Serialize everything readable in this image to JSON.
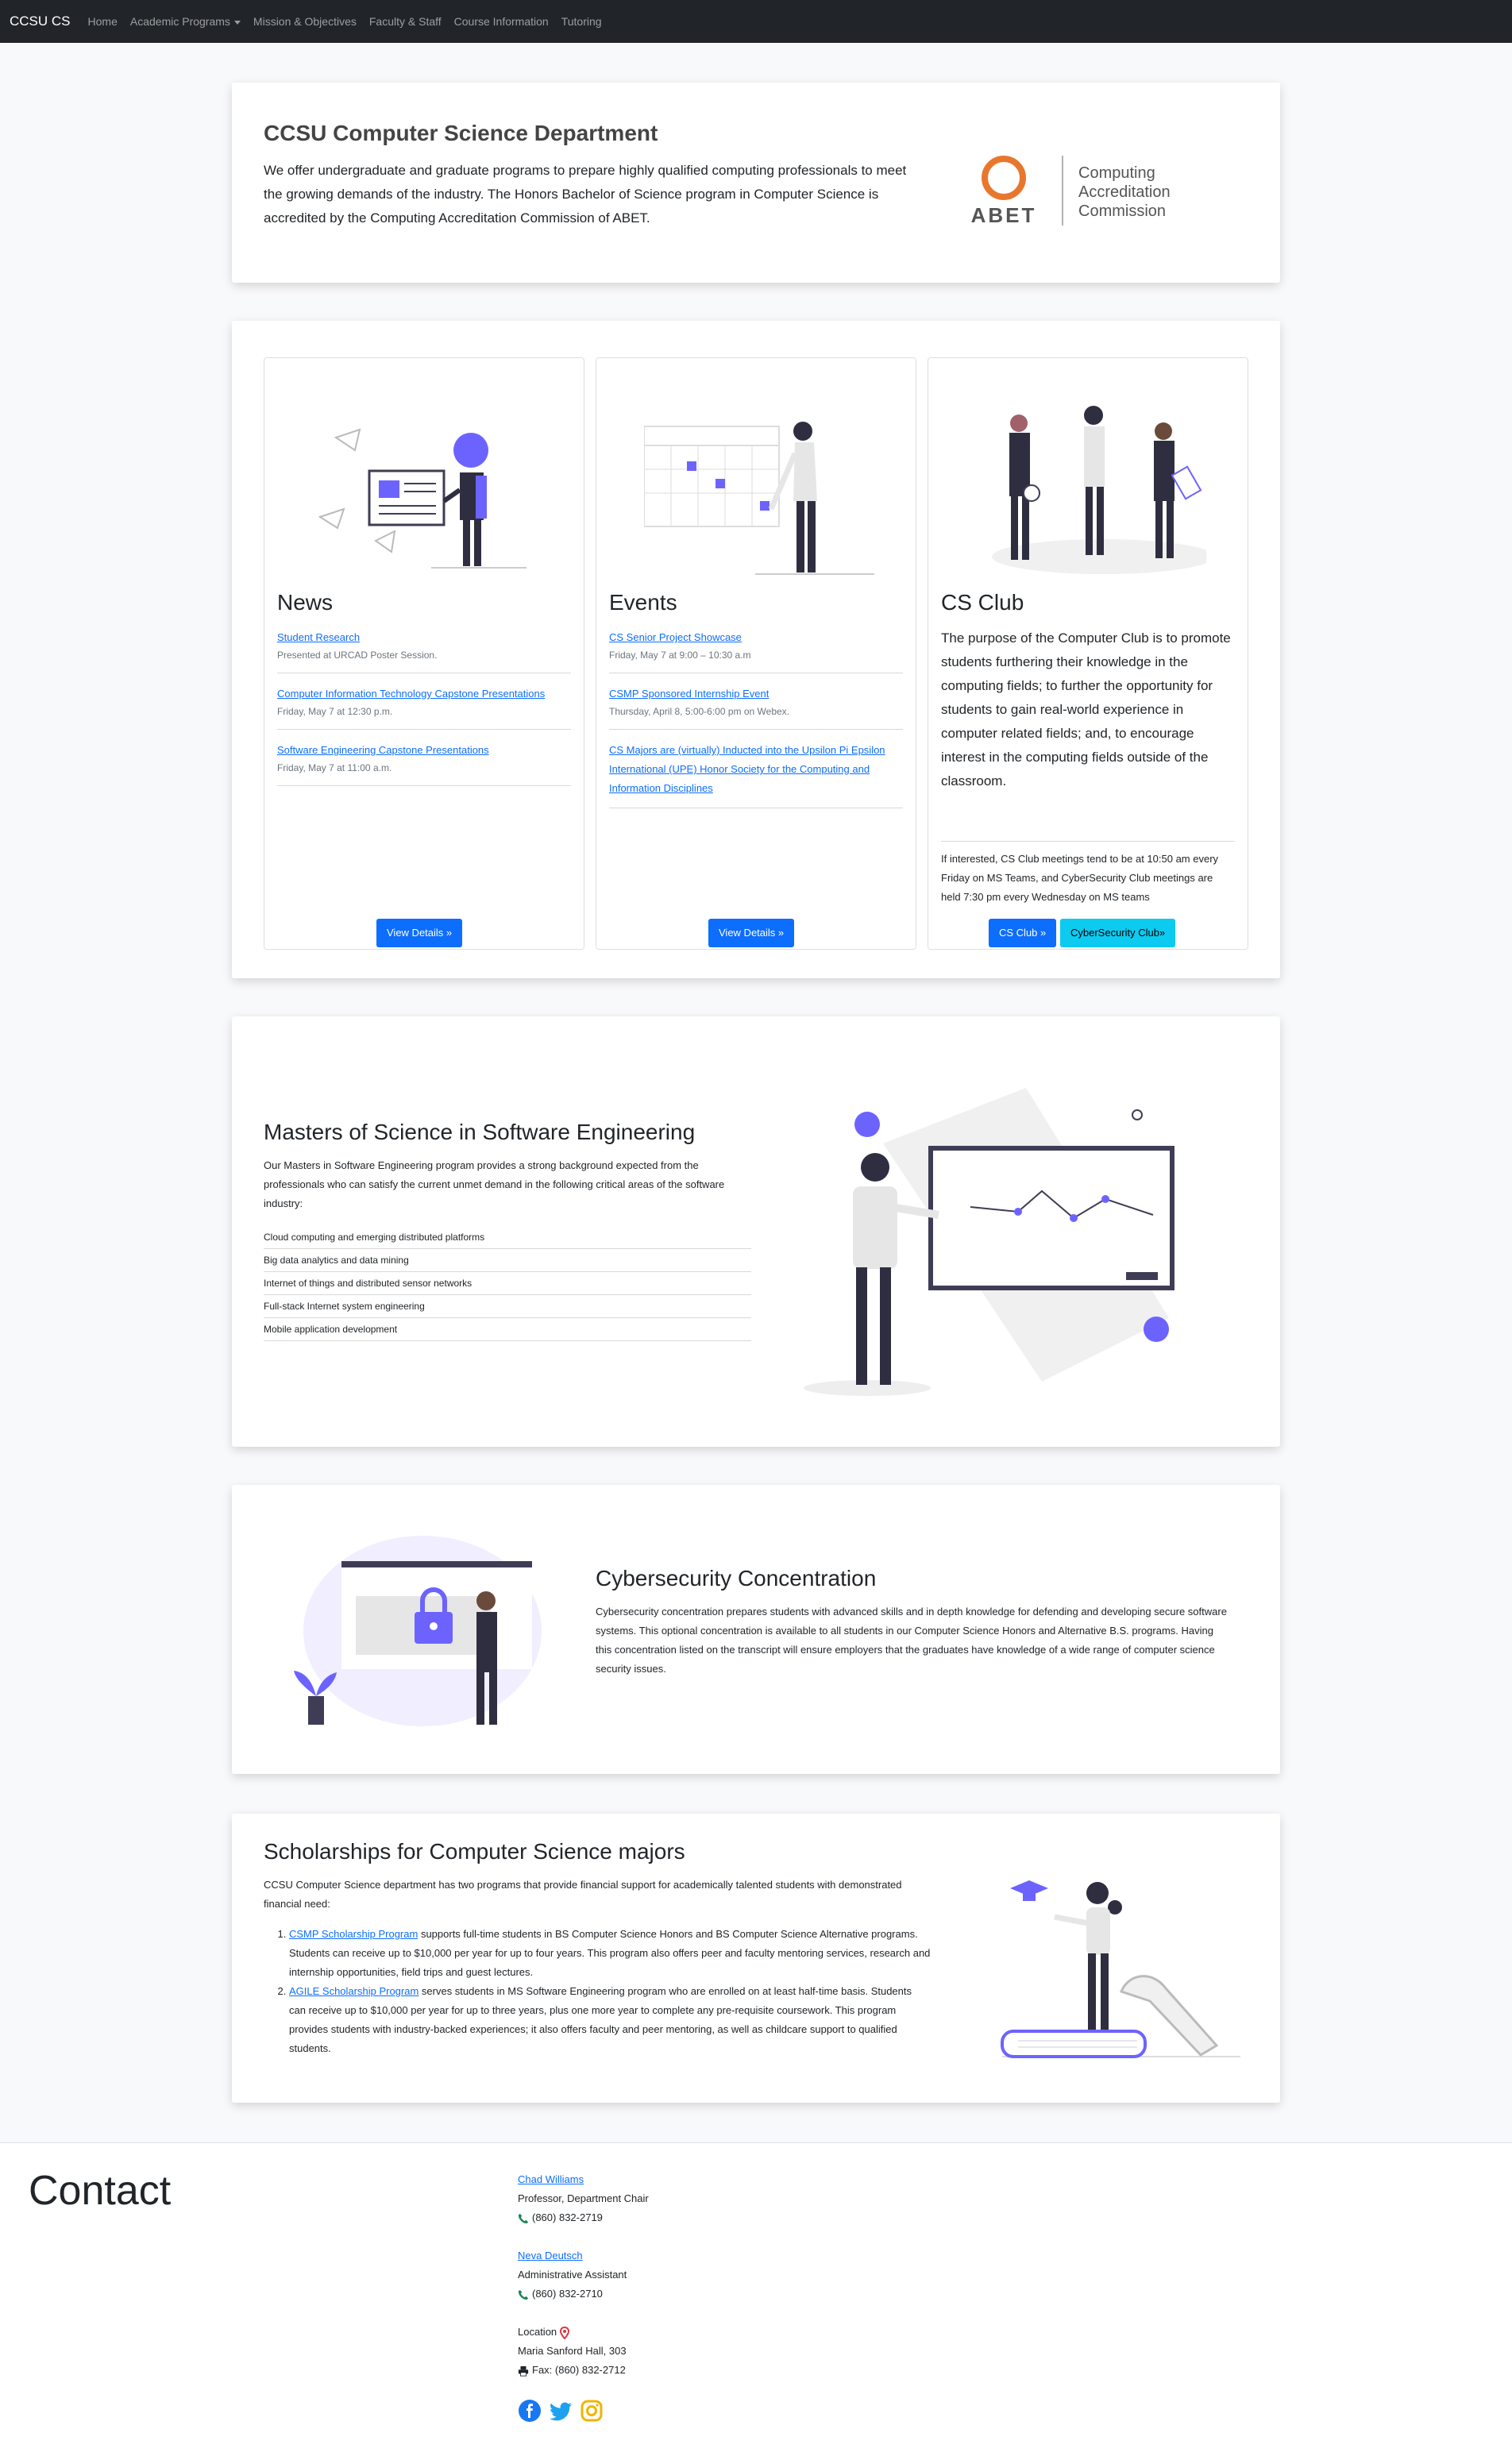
{
  "navbar": {
    "brand": "CCSU CS",
    "links": [
      "Home",
      "Academic Programs",
      "Mission & Objectives",
      "Faculty & Staff",
      "Course Information",
      "Tutoring"
    ]
  },
  "intro": {
    "title": "CCSU Computer Science Department",
    "text": "We offer undergraduate and graduate programs to prepare highly qualified computing professionals to meet the growing demands of the industry. The Honors Bachelor of Science program in Computer Science is accredited by the Computing Accreditation Commission of ABET.",
    "logo_word": "ABET",
    "logo_caption": [
      "Computing",
      "Accreditation",
      "Commission"
    ]
  },
  "news": {
    "title": "News",
    "items": [
      {
        "link": "Student Research",
        "meta": "Presented at URCAD Poster Session."
      },
      {
        "link": "Computer Information Technology Capstone Presentations",
        "meta": "Friday, May 7 at 12:30 p.m."
      },
      {
        "link": "Software Engineering Capstone Presentations",
        "meta": "Friday, May 7 at 11:00 a.m."
      }
    ],
    "button": "View Details »"
  },
  "events": {
    "title": "Events",
    "items": [
      {
        "link": "CS Senior Project Showcase",
        "meta": "Friday, May 7 at 9:00 – 10:30 a.m"
      },
      {
        "link": "CSMP Sponsored Internship Event",
        "meta": "Thursday, April 8, 5:00-6:00 pm on Webex."
      },
      {
        "link": "CS Majors are (virtually) Inducted into the Upsilon Pi Epsilon International (UPE) Honor Society for the Computing and Information Disciplines",
        "meta": ""
      }
    ],
    "button": "View Details »"
  },
  "club": {
    "title": "CS Club",
    "text": "The purpose of the Computer Club is to promote students furthering their knowledge in the computing fields; to further the opportunity for students to gain real-world experience in computer related fields; and, to encourage interest in the computing fields outside of the classroom.",
    "note": "If interested, CS Club meetings tend to be at 10:50 am every Friday on MS Teams, and CyberSecurity Club meetings are held 7:30 pm every Wednesday on MS teams",
    "button1": "CS Club »",
    "button2": "CyberSecurity Club»"
  },
  "mse": {
    "title": "Masters of Science in Software Engineering",
    "text": "Our Masters in Software Engineering program provides a strong background expected from the professionals who can satisfy the current unmet demand in the following critical areas of the software industry:",
    "areas": [
      "Cloud computing and emerging distributed platforms",
      "Big data analytics and data mining",
      "Internet of things and distributed sensor networks",
      "Full-stack Internet system engineering",
      "Mobile application development"
    ]
  },
  "cyber": {
    "title": "Cybersecurity Concentration",
    "text": "Cybersecurity concentration prepares students with advanced skills and in depth knowledge for defending and developing secure software systems. This optional concentration is available to all students in our Computer Science Honors and Alternative B.S. programs. Having this concentration listed on the transcript will ensure employers that the graduates have knowledge of a wide range of computer science security issues."
  },
  "scholar": {
    "title": "Scholarships for Computer Science majors",
    "intro": "CCSU Computer Science department has two programs that provide financial support for academically talented students with demonstrated financial need:",
    "items": [
      {
        "link": "CSMP Scholarship Program",
        "text": " supports full-time students in BS Computer Science Honors and BS Computer Science Alternative programs. Students can receive up to $10,000 per year for up to four years. This program also offers peer and faculty mentoring services, research and internship opportunities, field trips and guest lectures."
      },
      {
        "link": "AGILE Scholarship Program",
        "text": " serves students in MS Software Engineering program who are enrolled on at least half-time basis. Students can receive up to $10,000 per year for up to three years, plus one more year to complete any pre-requisite coursework. This program provides students with industry-backed experiences; it also offers faculty and peer mentoring, as well as childcare support to qualified students."
      }
    ]
  },
  "contact": {
    "title": "Contact",
    "person1": {
      "name": "Chad Williams",
      "role": "Professor, Department Chair",
      "phone": "(860) 832-2719"
    },
    "person2": {
      "name": "Neva Deutsch",
      "role": "Administrative Assistant",
      "phone": "(860) 832-2710"
    },
    "location_label": "Location",
    "location": "Maria Sanford Hall, 303",
    "fax": "Fax: (860) 832-2712"
  },
  "colors": {
    "accent": "#6c63ff",
    "primary": "#0d6efd",
    "info": "#0dcaf0",
    "dark": "#212529",
    "abet_orange": "#e8772e"
  }
}
